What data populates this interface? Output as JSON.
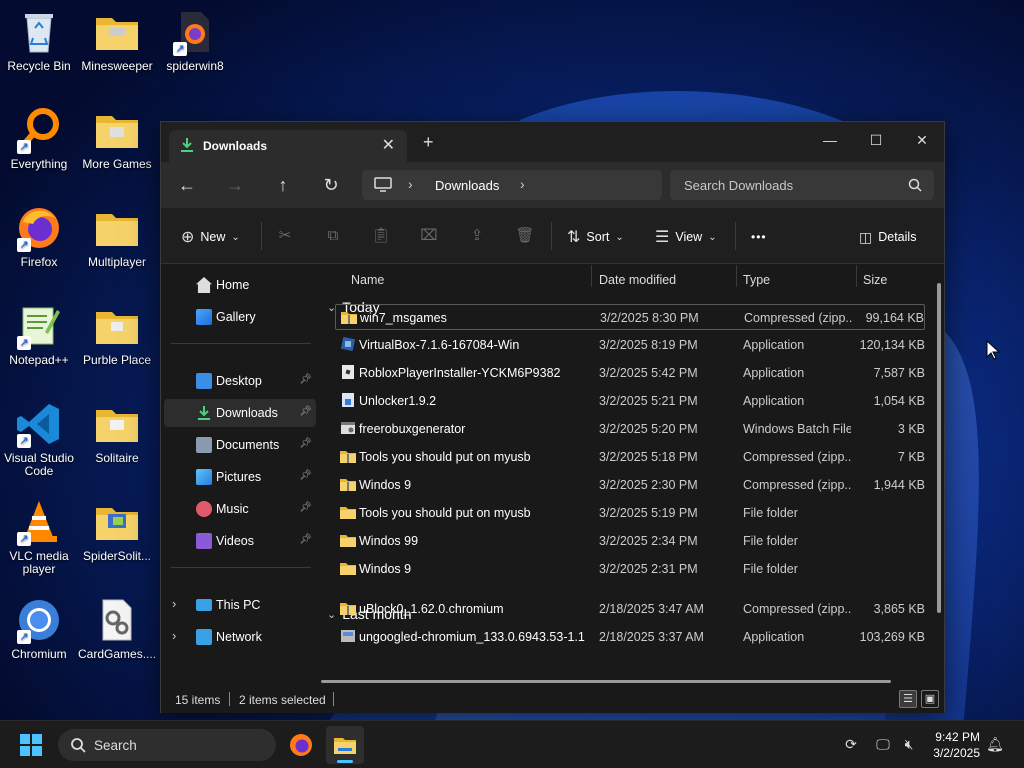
{
  "desktop": {
    "icons": [
      {
        "label": "Recycle Bin",
        "icon": "recycle-bin-icon"
      },
      {
        "label": "Minesweeper",
        "icon": "folder-icon"
      },
      {
        "label": "spiderwin8",
        "icon": "firefox-file-icon"
      },
      {
        "label": "Everything",
        "icon": "everything-search-icon"
      },
      {
        "label": "More Games",
        "icon": "folder-icon"
      },
      {
        "label": "Firefox",
        "icon": "firefox-icon"
      },
      {
        "label": "Multiplayer",
        "icon": "folder-icon"
      },
      {
        "label": "Notepad++",
        "icon": "notepadpp-icon"
      },
      {
        "label": "Purble Place",
        "icon": "folder-icon"
      },
      {
        "label": "Visual Studio Code",
        "icon": "vscode-icon"
      },
      {
        "label": "Solitaire",
        "icon": "folder-icon"
      },
      {
        "label": "VLC media player",
        "icon": "vlc-icon"
      },
      {
        "label": "SpiderSolit...",
        "icon": "folder-icon"
      },
      {
        "label": "Chromium",
        "icon": "chromium-icon"
      },
      {
        "label": "CardGames....",
        "icon": "settings-file-icon"
      }
    ]
  },
  "explorer": {
    "tab": {
      "title": "Downloads",
      "close": "✕"
    },
    "new_tab": "+",
    "window_controls": {
      "minimize": "—",
      "maximize": "☐",
      "close": "✕"
    },
    "address": {
      "crumb": "Downloads"
    },
    "search": {
      "placeholder": "Search Downloads"
    },
    "toolbar": {
      "new_label": "New",
      "sort_label": "Sort",
      "view_label": "View",
      "more_label": "•••",
      "details_label": "Details"
    },
    "sidebar": {
      "items": [
        {
          "label": "Home",
          "icon": "home-icon"
        },
        {
          "label": "Gallery",
          "icon": "gallery-icon"
        },
        {
          "label": "Desktop",
          "icon": "desktop-icon",
          "pinned": true
        },
        {
          "label": "Downloads",
          "icon": "download-icon",
          "pinned": true,
          "active": true
        },
        {
          "label": "Documents",
          "icon": "documents-icon",
          "pinned": true
        },
        {
          "label": "Pictures",
          "icon": "pictures-icon",
          "pinned": true
        },
        {
          "label": "Music",
          "icon": "music-icon",
          "pinned": true
        },
        {
          "label": "Videos",
          "icon": "videos-icon",
          "pinned": true
        },
        {
          "label": "This PC",
          "icon": "this-pc-icon"
        },
        {
          "label": "Network",
          "icon": "network-icon"
        }
      ]
    },
    "columns": {
      "name": "Name",
      "date": "Date modified",
      "type": "Type",
      "size": "Size"
    },
    "groups": [
      {
        "title": "Today",
        "files": [
          {
            "name": "win7_msgames",
            "date": "3/2/2025 8:30 PM",
            "type": "Compressed (zipp...",
            "size": "99,164 KB",
            "icon": "zip-icon"
          },
          {
            "name": "VirtualBox-7.1.6-167084-Win",
            "date": "3/2/2025 8:19 PM",
            "type": "Application",
            "size": "120,134 KB",
            "icon": "virtualbox-icon"
          },
          {
            "name": "RobloxPlayerInstaller-YCKM6P9382",
            "date": "3/2/2025 5:42 PM",
            "type": "Application",
            "size": "7,587 KB",
            "icon": "roblox-icon"
          },
          {
            "name": "Unlocker1.9.2",
            "date": "3/2/2025 5:21 PM",
            "type": "Application",
            "size": "1,054 KB",
            "icon": "unlocker-icon"
          },
          {
            "name": "freerobuxgenerator",
            "date": "3/2/2025 5:20 PM",
            "type": "Windows Batch File",
            "size": "3 KB",
            "icon": "batch-file-icon"
          },
          {
            "name": "Tools you should put on myusb",
            "date": "3/2/2025 5:18 PM",
            "type": "Compressed (zipp...",
            "size": "7 KB",
            "icon": "zip-icon"
          },
          {
            "name": "Windos 9",
            "date": "3/2/2025 2:30 PM",
            "type": "Compressed (zipp...",
            "size": "1,944 KB",
            "icon": "zip-icon"
          },
          {
            "name": "Tools you should put on myusb",
            "date": "3/2/2025 5:19 PM",
            "type": "File folder",
            "size": "",
            "icon": "folder-icon"
          },
          {
            "name": "Windos 99",
            "date": "3/2/2025 2:34 PM",
            "type": "File folder",
            "size": "",
            "icon": "folder-icon"
          },
          {
            "name": "Windos 9",
            "date": "3/2/2025 2:31 PM",
            "type": "File folder",
            "size": "",
            "icon": "folder-icon"
          }
        ]
      },
      {
        "title": "Last month",
        "files": [
          {
            "name": "uBlock0_1.62.0.chromium",
            "date": "2/18/2025 3:47 AM",
            "type": "Compressed (zipp...",
            "size": "3,865 KB",
            "icon": "zip-icon"
          },
          {
            "name": "ungoogled-chromium_133.0.6943.53-1.1",
            "date": "2/18/2025 3:37 AM",
            "type": "Application",
            "size": "103,269 KB",
            "icon": "installer-icon"
          }
        ]
      }
    ],
    "status": {
      "items": "15 items",
      "selected": "2 items selected"
    }
  },
  "taskbar": {
    "search_label": "Search",
    "clock_time": "9:42 PM",
    "clock_date": "3/2/2025"
  },
  "colors": {
    "accent": "#4cc2ff",
    "folder": "#f3c94d",
    "window_bg": "#191919"
  }
}
